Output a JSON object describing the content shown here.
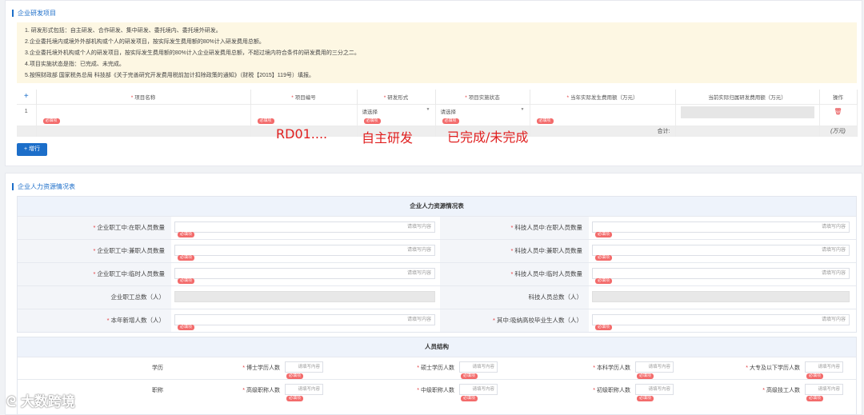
{
  "rd_section": {
    "title": "企业研发项目",
    "notes": [
      "1. 研发形式包括：自主研发、合作研发、集中研发、委托境内、委托境外研发。",
      "2.企业委托境内或境外外部机构或个人的研发项目，按实际发生费用额的80%计入研发费用总额。",
      "3.企业委托境外机构或个人的研发项目，按实际发生费用额的80%计入企业研发费用总额，不超过境内符合条件的研发费用的三分之二。",
      "4.项目实施状态是指：已完成、未完成。",
      "5.按照财政部 国家税务总局 科技部《关于完善研究开发费用税前加计扣除政策的通知》（财税【2015】119号）填报。"
    ],
    "table": {
      "add_icon": "+",
      "headers": [
        "项目名称",
        "项目编号",
        "研发形式",
        "项目实施状态",
        "当年实际发生费用额（万元）",
        "当前实际归属研发费用额（万元）",
        "操作"
      ],
      "row": {
        "index": "1",
        "form_placeholder": "请选择",
        "status_placeholder": "请选择",
        "delete_icon": "trash-icon"
      },
      "required_tag": "必填项",
      "sum_label": "合计:",
      "sum_unit": "(万元)"
    },
    "add_row_button": "+ 增行",
    "overlays": {
      "project_code": "RD01....",
      "research_form": "自主研发",
      "status": "已完成/未完成"
    }
  },
  "hr_section": {
    "title": "企业人力资源情况表",
    "table_title": "企业人力资源情况表",
    "placeholder": "请填写内容",
    "required_tag": "必填项",
    "rows": [
      {
        "left": "企业职工中:在职人员数量",
        "left_req": true,
        "right": "科技人员中:在职人员数量",
        "right_req": true
      },
      {
        "left": "企业职工中:兼职人员数量",
        "left_req": true,
        "right": "科技人员中:兼职人员数量",
        "right_req": true
      },
      {
        "left": "企业职工中:临时人员数量",
        "left_req": true,
        "right": "科技人员中:临时人员数量",
        "right_req": true
      },
      {
        "left": "企业职工总数（人）",
        "left_req": false,
        "right": "科技人员总数（人）",
        "right_req": false
      },
      {
        "left": "本年新增人数（人）",
        "left_req": true,
        "right": "其中:吸纳高校毕业生人数（人）",
        "right_req": true
      }
    ],
    "structure_title": "人员结构",
    "education": {
      "label": "学历",
      "items": [
        "博士学历人数",
        "硕士学历人数",
        "本科学历人数",
        "大专及以下学历人数"
      ]
    },
    "title_rank": {
      "label": "职称",
      "items": [
        "高级职称人数",
        "中级职称人数",
        "初级职称人数",
        "高级技工人数"
      ]
    }
  },
  "watermark": "大数跨境"
}
